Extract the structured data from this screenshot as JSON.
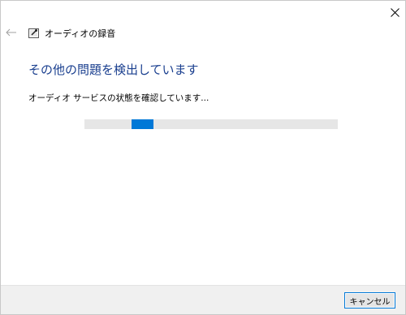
{
  "window": {
    "title": "オーディオの録音",
    "close_icon": "close-icon",
    "back_icon": "back-arrow-icon",
    "app_icon": "audio-troubleshooter-icon"
  },
  "main": {
    "heading": "その他の問題を検出しています",
    "status": "オーディオ サービスの状態を確認しています..."
  },
  "progress": {
    "mode": "indeterminate",
    "chunk_start_fraction": 0.186,
    "chunk_width_fraction": 0.087,
    "accent_color": "#0078d7",
    "track_color": "#e6e6e6"
  },
  "footer": {
    "cancel_label": "キャンセル"
  },
  "colors": {
    "heading": "#1a3f8f",
    "footer_bg": "#f0f0f0"
  }
}
